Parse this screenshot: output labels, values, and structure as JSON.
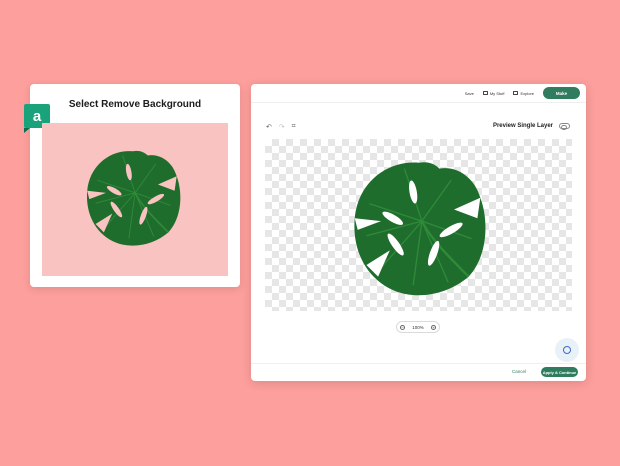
{
  "left_panel": {
    "logo_letter": "a",
    "title": "Select Remove Background"
  },
  "editor": {
    "nav": {
      "save": "Save",
      "my_stuff": "My Stuff",
      "explore": "Explore",
      "make": "Make"
    },
    "toolbar": {
      "undo_icon": "↶",
      "redo_icon": "↷",
      "crop_icon": "⌗"
    },
    "preview_single_layer": "Preview Single Layer",
    "zoom": {
      "value": "100%",
      "minus": "−",
      "plus": "+"
    },
    "footer": {
      "cancel": "Cancel",
      "apply": "Apply & Continue"
    }
  },
  "colors": {
    "background": "#fd9f9c",
    "accent": "#2f7c5e",
    "logo": "#1aa37a",
    "preview_bg": "#f8c3c0",
    "leaf": "#1f6d2c"
  }
}
